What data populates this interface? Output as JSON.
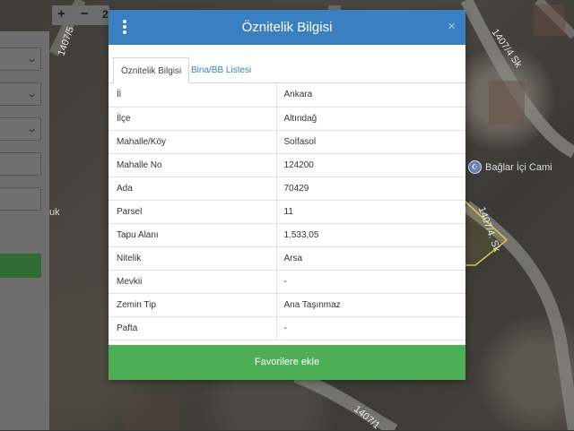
{
  "map": {
    "road_labels": [
      "1407/5",
      "1407/4 Sk",
      "1407/4. Sk",
      "1407/1"
    ],
    "poi_icon": "mosque-pin-icon",
    "poi_label": "Bağlar İçi Cami",
    "left_edge_label": "uk"
  },
  "zoom": {
    "zoom_in": "+",
    "zoom_out": "−",
    "extra": "2"
  },
  "left_panel": {
    "dropdown_icon": "chevron-down-icon"
  },
  "modal": {
    "menu_icon": "kebab-menu-icon",
    "title": "Öznitelik Bilgisi",
    "close": "×",
    "tabs": [
      {
        "label": "Öznitelik Bilgisi",
        "active": true
      },
      {
        "label": "Bina/BB Listesi",
        "active": false
      }
    ],
    "rows": [
      {
        "key": "İl",
        "value": "Ankara"
      },
      {
        "key": "İlçe",
        "value": "Altındağ"
      },
      {
        "key": "Mahalle/Köy",
        "value": "Solfasol"
      },
      {
        "key": "Mahalle No",
        "value": "124200"
      },
      {
        "key": "Ada",
        "value": "70429"
      },
      {
        "key": "Parsel",
        "value": "11"
      },
      {
        "key": "Tapu Alanı",
        "value": "1.533,05"
      },
      {
        "key": "Nitelik",
        "value": "Arsa"
      },
      {
        "key": "Mevkii",
        "value": "-"
      },
      {
        "key": "Zemin Tip",
        "value": "Ana Taşınmaz"
      },
      {
        "key": "Pafta",
        "value": "-"
      }
    ],
    "favorite_button": "Favorilere ekle"
  },
  "colors": {
    "header_blue": "#3a7fc1",
    "tab_link": "#3a7fc1",
    "favorite_green": "#4cae55"
  }
}
